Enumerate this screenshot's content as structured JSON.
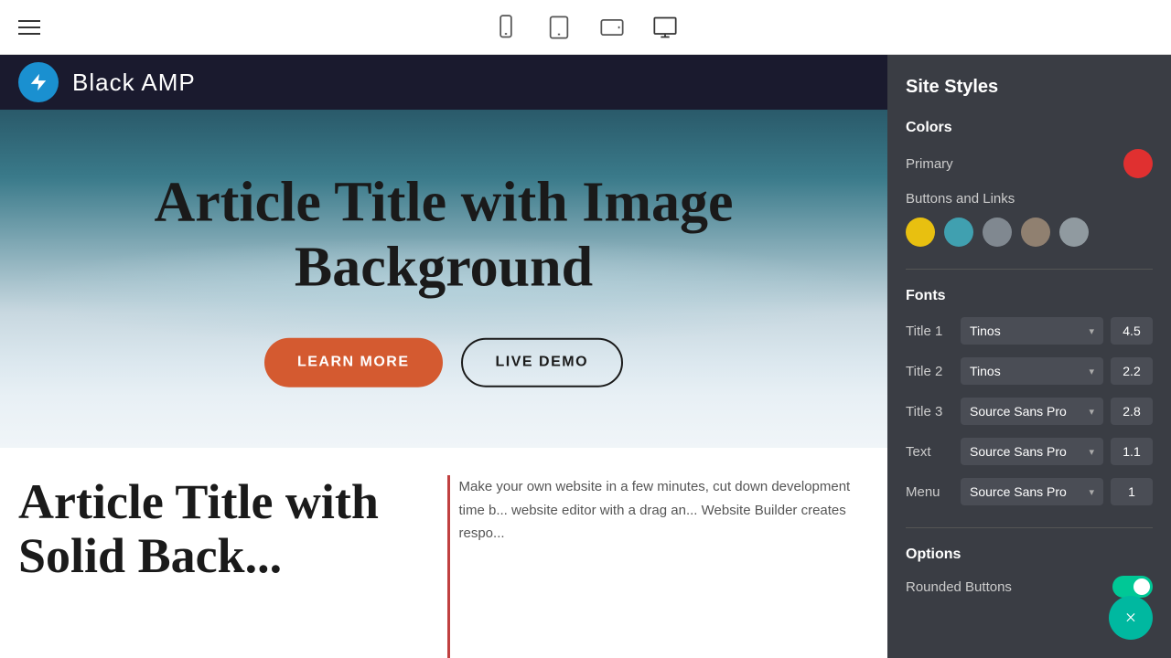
{
  "toolbar": {
    "devices": [
      {
        "name": "mobile",
        "label": "Mobile"
      },
      {
        "name": "tablet",
        "label": "Tablet"
      },
      {
        "name": "tablet-landscape",
        "label": "Tablet Landscape"
      },
      {
        "name": "desktop",
        "label": "Desktop"
      }
    ]
  },
  "site_header": {
    "title": "Black AMP",
    "logo_alt": "Black AMP logo"
  },
  "hero": {
    "title": "Article Title with Image Background",
    "btn_learn_more": "LEARN MORE",
    "btn_live_demo": "LIVE DEMO"
  },
  "lower_section": {
    "article_title": "Article Title with Solid Back...",
    "body_text": "Make your own website in a few minutes, cut down development time b... website editor with a drag an... Website Builder creates respo..."
  },
  "site_styles": {
    "panel_title": "Site Styles",
    "colors": {
      "section_label": "Colors",
      "primary_label": "Primary",
      "primary_color": "#e03030",
      "buttons_links_label": "Buttons and Links",
      "swatches": [
        {
          "color": "#e8c010",
          "name": "yellow"
        },
        {
          "color": "#40a0b0",
          "name": "teal"
        },
        {
          "color": "#808890",
          "name": "gray"
        },
        {
          "color": "#908070",
          "name": "warm-gray"
        },
        {
          "color": "#909aa0",
          "name": "cool-gray"
        }
      ]
    },
    "fonts": {
      "section_label": "Fonts",
      "rows": [
        {
          "label": "Title 1",
          "font": "Tinos",
          "size": "4.5"
        },
        {
          "label": "Title 2",
          "font": "Tinos",
          "size": "2.2"
        },
        {
          "label": "Title 3",
          "font": "Source Sans Pro",
          "size": "2.8"
        },
        {
          "label": "Text",
          "font": "Source Sans Pro",
          "size": "1.1"
        },
        {
          "label": "Menu",
          "font": "Source Sans Pro",
          "size": "1"
        }
      ]
    },
    "options": {
      "section_label": "Options",
      "rounded_buttons_label": "Rounded Buttons",
      "rounded_buttons_on": true
    },
    "close_btn_label": "×"
  }
}
